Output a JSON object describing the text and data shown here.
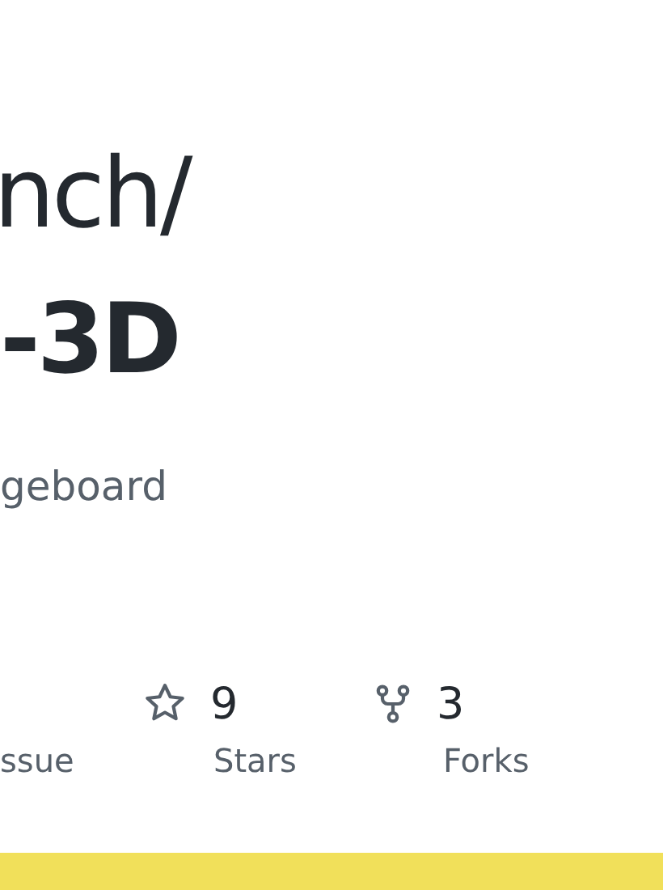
{
  "title": {
    "owner_part": "nch/",
    "repo_part": "-3D"
  },
  "description": "geboard",
  "stats": [
    {
      "kind": "text",
      "label": "ssue"
    },
    {
      "kind": "star",
      "value": "9",
      "label": "Stars"
    },
    {
      "kind": "fork",
      "value": "3",
      "label": "Forks"
    }
  ],
  "accent_bar": {
    "color": "#f1e05a"
  }
}
